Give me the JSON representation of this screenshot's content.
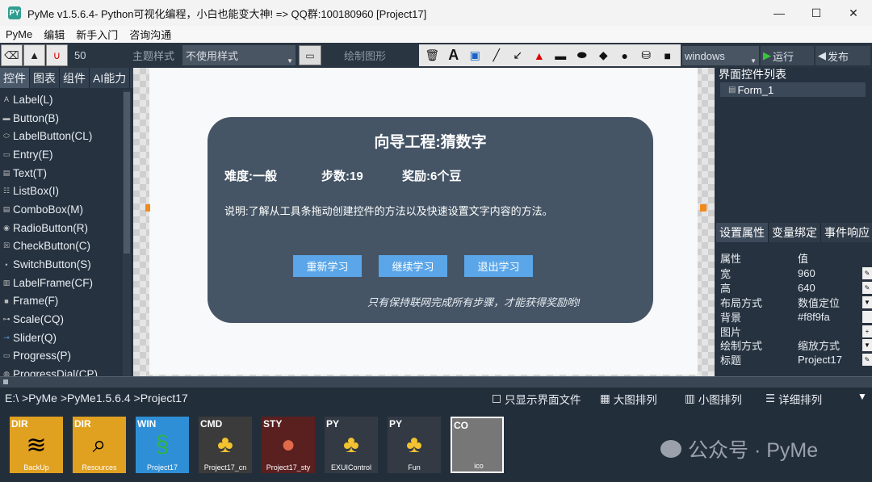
{
  "window": {
    "app_icon": "PY",
    "title": "PyMe v1.5.6.4- Python可视化编程，小白也能变大神!  => QQ群:100180960   [Project17]"
  },
  "menu": [
    "PyMe",
    "编辑",
    "新手入门",
    "咨询沟通"
  ],
  "toolbar": {
    "size_value": "50",
    "theme_label": "主题样式",
    "theme_value": "不使用样式",
    "draw_label": "绘制图形",
    "platform_value": "windows",
    "run_label": "运行",
    "publish_label": "发布"
  },
  "left_panel": {
    "tabs": [
      "控件",
      "图表",
      "组件",
      "AI能力"
    ],
    "items": [
      "Label(L)",
      "Button(B)",
      "LabelButton(CL)",
      "Entry(E)",
      "Text(T)",
      "ListBox(I)",
      "ComboBox(M)",
      "RadioButton(R)",
      "CheckButton(C)",
      "SwitchButton(S)",
      "LabelFrame(CF)",
      "Frame(F)",
      "Scale(CQ)",
      "Slider(Q)",
      "Progress(P)",
      "ProgressDial(CP)"
    ]
  },
  "form": {
    "title": "向导工程:猜数字",
    "difficulty": "难度:一般",
    "steps": "步数:19",
    "reward": "奖励:6个豆",
    "description": "说明:了解从工具条拖动创建控件的方法以及快速设置文字内容的方法。",
    "buttons": [
      "重新学习",
      "继续学习",
      "退出学习"
    ],
    "note": "只有保持联网完成所有步骤，才能获得奖励哟!"
  },
  "right_panel": {
    "title": "界面控件列表",
    "tree_item": "Form_1",
    "tabs": [
      "设置属性",
      "变量绑定",
      "事件响应"
    ],
    "header_key": "属性",
    "header_value": "值",
    "properties": [
      {
        "k": "宽",
        "v": "960"
      },
      {
        "k": "高",
        "v": "640"
      },
      {
        "k": "布局方式",
        "v": "数值定位"
      },
      {
        "k": "背景",
        "v": "#f8f9fa"
      },
      {
        "k": "图片",
        "v": ""
      },
      {
        "k": "绘制方式",
        "v": "缩放方式"
      },
      {
        "k": "标题",
        "v": "Project17"
      }
    ]
  },
  "bottom_panel": {
    "path": "E:\\ >PyMe >PyMe1.5.6.4 >Project17",
    "option_ui_only": "只显示界面文件",
    "option_large": "大图排列",
    "option_small": "小图排列",
    "option_detail": "详细排列",
    "files": [
      {
        "tag": "DIR",
        "name": "BackUp",
        "color": "#e0a020"
      },
      {
        "tag": "DIR",
        "name": "Resources",
        "color": "#e0a020"
      },
      {
        "tag": "WIN",
        "name": "Project17",
        "color": "#2f8fd6"
      },
      {
        "tag": "CMD",
        "name": "Project17_cn",
        "color": "#3b3b3b"
      },
      {
        "tag": "STY",
        "name": "Project17_sty",
        "color": "#5a1f1f"
      },
      {
        "tag": "PY",
        "name": "EXUIControl",
        "color": "#333a44"
      },
      {
        "tag": "PY",
        "name": "Fun",
        "color": "#333a44"
      },
      {
        "tag": "CO",
        "name": "ico",
        "color": "#777777"
      }
    ],
    "watermark": "公众号 · PyMe"
  }
}
